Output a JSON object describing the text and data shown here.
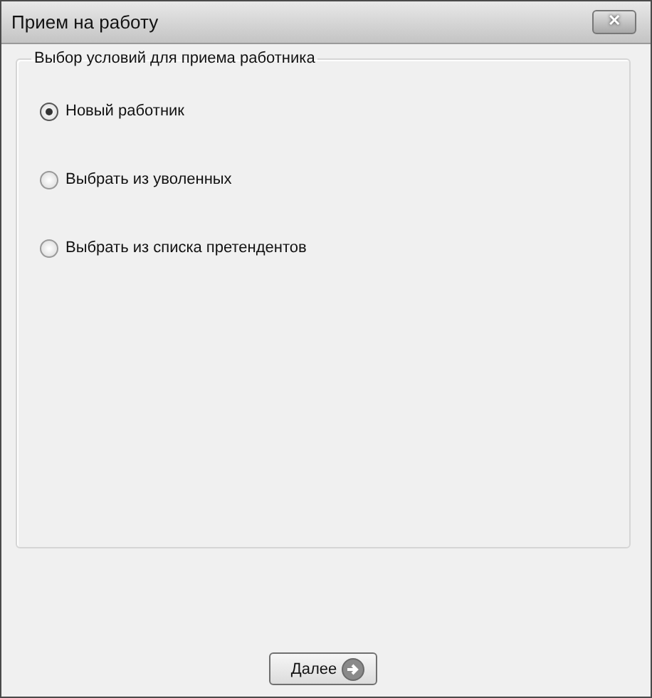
{
  "window": {
    "title": "Прием на работу",
    "close_button": "✕"
  },
  "group": {
    "title": "Выбор условий для приема работника",
    "options": [
      {
        "label": "Новый работник",
        "selected": true
      },
      {
        "label": "Выбрать из уволенных",
        "selected": false
      },
      {
        "label": "Выбрать из списка претендентов",
        "selected": false
      }
    ]
  },
  "buttons": [
    {
      "label": "Далее"
    }
  ]
}
